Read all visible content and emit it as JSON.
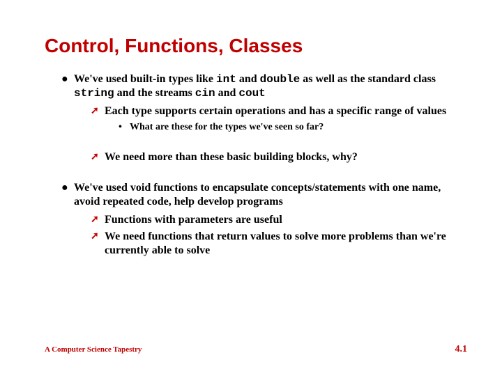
{
  "title": "Control, Functions, Classes",
  "b1a_pre": "We've used built-in types like ",
  "b1a_c1": "int",
  "b1a_mid1": " and ",
  "b1a_c2": "double",
  "b1a_mid2": " as well as the standard class ",
  "b1a_c3": "string",
  "b1a_mid3": " and the streams ",
  "b1a_c4": "cin",
  "b1a_mid4": " and ",
  "b1a_c5": "cout",
  "b1a_sub1": "Each type supports certain operations and has a specific range of values",
  "b1a_sub1_q": "What are these for the types we've seen so far?",
  "b1a_sub2": "We need more than these basic building blocks, why?",
  "b2": "We've used void functions to encapsulate concepts/statements with one name, avoid repeated code, help develop programs",
  "b2_sub1": "Functions with parameters are useful",
  "b2_sub2": "We need functions that return values to solve more problems than we're currently able to solve",
  "footer_left": "A Computer Science Tapestry",
  "footer_right": "4.1"
}
